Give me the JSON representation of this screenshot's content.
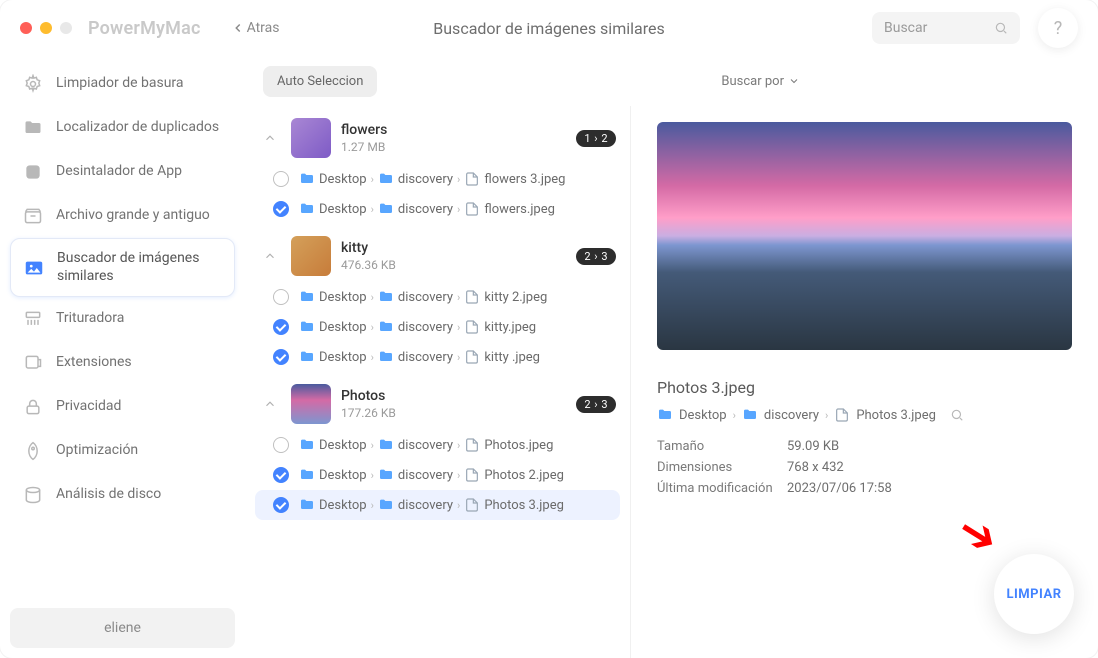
{
  "app_name": "PowerMyMac",
  "back_label": "Atras",
  "header_title": "Buscador de imágenes similares",
  "search_placeholder": "Buscar",
  "sidebar": {
    "items": [
      {
        "label": "Limpiador de basura"
      },
      {
        "label": "Localizador de duplicados"
      },
      {
        "label": "Desintalador de App"
      },
      {
        "label": "Archivo grande y antiguo"
      },
      {
        "label": "Buscador de imágenes similares"
      },
      {
        "label": "Trituradora"
      },
      {
        "label": "Extensiones"
      },
      {
        "label": "Privacidad"
      },
      {
        "label": "Optimización"
      },
      {
        "label": "Análisis de disco"
      }
    ],
    "user": "eliene"
  },
  "toolbar": {
    "auto": "Auto Seleccion",
    "sort": "Buscar por"
  },
  "path": {
    "desktop": "Desktop",
    "discovery": "discovery"
  },
  "groups": [
    {
      "name": "flowers",
      "size": "1.27 MB",
      "badge": "1 › 2",
      "files": [
        {
          "name": "flowers 3.jpeg",
          "checked": false
        },
        {
          "name": "flowers.jpeg",
          "checked": true
        }
      ]
    },
    {
      "name": "kitty",
      "size": "476.36 KB",
      "badge": "2 › 3",
      "files": [
        {
          "name": "kitty 2.jpeg",
          "checked": false
        },
        {
          "name": "kitty.jpeg",
          "checked": true
        },
        {
          "name": "kitty .jpeg",
          "checked": true
        }
      ]
    },
    {
      "name": "Photos",
      "size": "177.26 KB",
      "badge": "2 › 3",
      "files": [
        {
          "name": "Photos.jpeg",
          "checked": false
        },
        {
          "name": "Photos 2.jpeg",
          "checked": true
        },
        {
          "name": "Photos 3.jpeg",
          "checked": true,
          "selected": true
        }
      ]
    }
  ],
  "preview": {
    "name": "Photos 3.jpeg",
    "path_file": "Photos 3.jpeg",
    "meta": {
      "size_label": "Tamaño",
      "size": "59.09 KB",
      "dim_label": "Dimensiones",
      "dim": "768 x 432",
      "mod_label": "Última modificación",
      "mod": "2023/07/06 17:58"
    }
  },
  "clean_label": "LIMPIAR"
}
